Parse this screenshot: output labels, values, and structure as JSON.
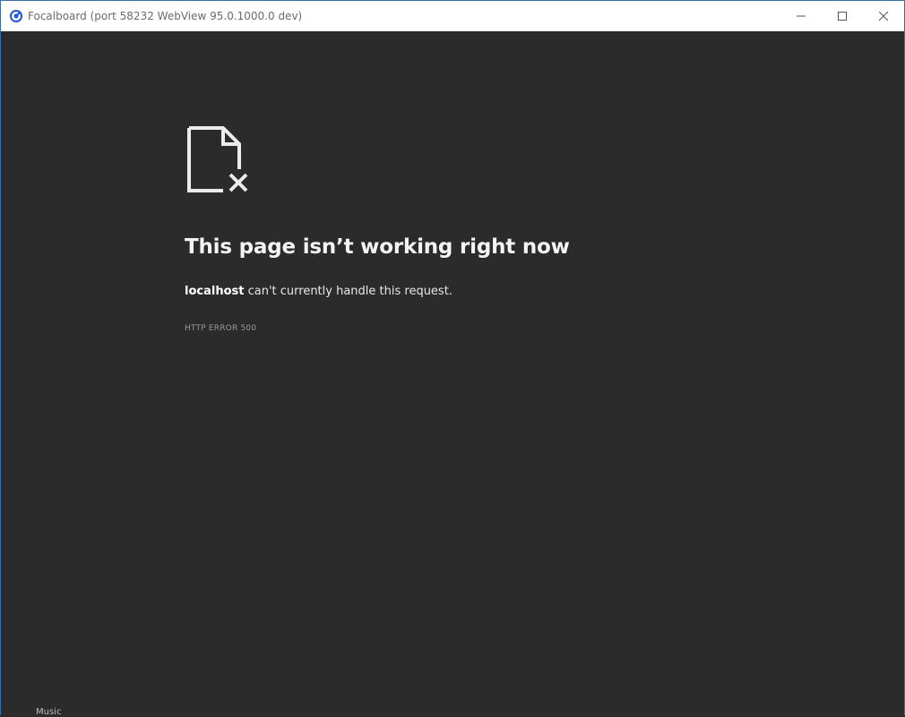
{
  "window": {
    "title": "Focalboard (port 58232 WebView 95.0.1000.0 dev)",
    "minimize_icon": "minimize-icon",
    "maximize_icon": "maximize-icon",
    "close_icon": "close-icon"
  },
  "error_page": {
    "icon": "broken-file-icon",
    "headline": "This page isn’t working right now",
    "host": "localhost",
    "message_rest": " can't currently handle this request.",
    "error_code": "HTTP ERROR 500"
  },
  "background": {
    "taskbar_peek": "Music"
  },
  "colors": {
    "page_background": "#2b2b2b",
    "titlebar_background": "#ffffff",
    "text_primary": "#f4f4f4",
    "text_muted": "#9a9a9a"
  }
}
